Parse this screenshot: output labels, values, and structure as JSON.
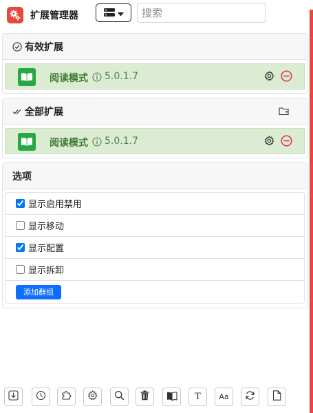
{
  "app": {
    "title": "扩展管理器",
    "accent_color": "#e9473b"
  },
  "header": {
    "menu_icon": "server-stack-icon",
    "search_placeholder": "搜索"
  },
  "enabled_section": {
    "title": "有效扩展",
    "icon": "check-circle-icon",
    "extensions": [
      {
        "name": "阅读模式",
        "version": "5.0.1.7",
        "enabled": true
      }
    ]
  },
  "all_section": {
    "title": "全部扩展",
    "icon": "check-double-icon",
    "folder_icon": "folder-icon",
    "extensions": [
      {
        "name": "阅读模式",
        "version": "5.0.1.7",
        "enabled": true
      }
    ]
  },
  "options_section": {
    "title": "选项",
    "options": [
      {
        "label": "显示启用禁用",
        "checked": true
      },
      {
        "label": "显示移动",
        "checked": false
      },
      {
        "label": "显示配置",
        "checked": true
      },
      {
        "label": "显示拆卸",
        "checked": false
      }
    ],
    "add_group_label": "添加群组"
  },
  "toolbar": {
    "buttons": [
      {
        "icon": "download-icon"
      },
      {
        "icon": "history-icon"
      },
      {
        "icon": "puzzle-icon"
      },
      {
        "icon": "gear-icon"
      },
      {
        "icon": "search-icon"
      },
      {
        "icon": "trash-icon"
      },
      {
        "icon": "book-icon"
      },
      {
        "icon": "text-icon",
        "label": "T"
      },
      {
        "icon": "font-size-icon",
        "label": "Aa"
      },
      {
        "icon": "refresh-icon"
      },
      {
        "icon": "file-icon"
      }
    ]
  }
}
